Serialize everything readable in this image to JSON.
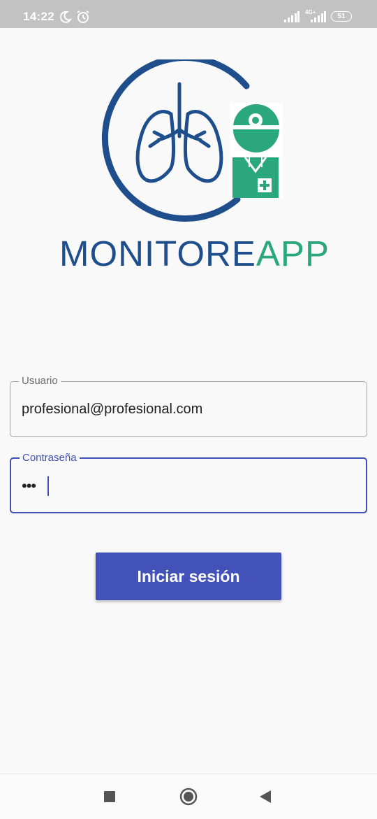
{
  "status_bar": {
    "time": "14:22",
    "battery": "51",
    "network": "4G+",
    "icons": [
      "moon-icon",
      "alarm-icon",
      "signal-icon",
      "signal-4g-icon",
      "battery-icon"
    ]
  },
  "logo": {
    "text_part1": "MONITORE",
    "text_part2": "APP",
    "colors": {
      "blue": "#1f4e8c",
      "green": "#2aa77d"
    }
  },
  "form": {
    "username": {
      "label": "Usuario",
      "value": "profesional@profesional.com"
    },
    "password": {
      "label": "Contraseña",
      "masked_value": "•••"
    },
    "submit_label": "Iniciar sesión"
  },
  "nav_bar": {
    "buttons": [
      "recent-apps-icon",
      "home-icon",
      "back-icon"
    ]
  },
  "colors": {
    "accent": "#3f51b5",
    "button": "#4352b8",
    "status_bar": "#c2c2c2"
  }
}
